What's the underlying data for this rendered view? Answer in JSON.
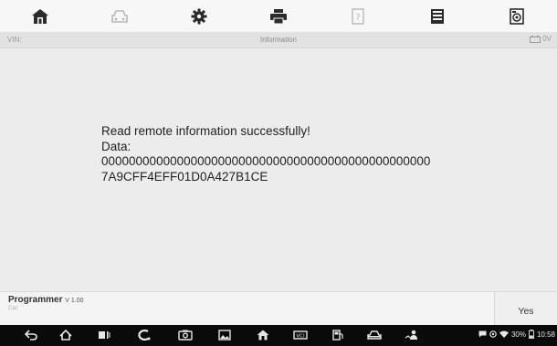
{
  "toolbar": {
    "items": [
      {
        "icon": "home-icon",
        "enabled": true
      },
      {
        "icon": "vehicle-icon",
        "enabled": false
      },
      {
        "icon": "settings-gear-icon",
        "enabled": true
      },
      {
        "icon": "print-icon",
        "enabled": true
      },
      {
        "icon": "help-icon",
        "enabled": false
      },
      {
        "icon": "save-icon",
        "enabled": true
      },
      {
        "icon": "data-logging-icon",
        "enabled": true
      }
    ]
  },
  "infobar": {
    "vin_label": "VIN:",
    "title": "Information",
    "battery_text": "0V"
  },
  "message": {
    "line1": "Read remote information successfully!",
    "line2": "Data:",
    "line3": "000000000000000000000000000000000000000000000000",
    "line4": "7A9CFF4EFF01D0A427B1CE"
  },
  "footer": {
    "app_name": "Programmer",
    "version": "V 1.00",
    "car_label": "Car:",
    "yes_label": "Yes"
  },
  "navbar": {
    "battery_percent": "30%",
    "time": "10:58"
  },
  "colors": {
    "toolbar_bg": "#f7f7f7",
    "icon_dark": "#2b2b2b",
    "icon_disabled": "#b8b8b8",
    "nav_bg": "#0a0a0a"
  }
}
